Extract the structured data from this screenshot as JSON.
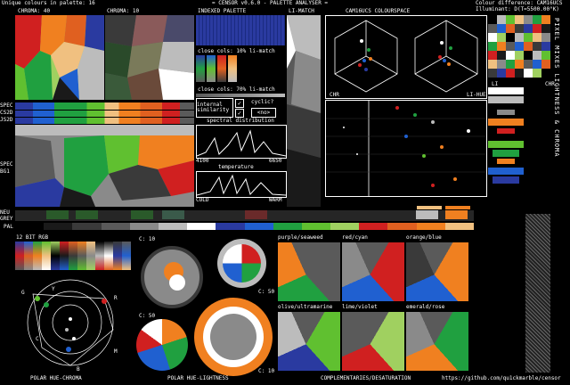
{
  "header": {
    "unique_colours": "Unique colours in palette: 16",
    "app_title": "= CENSOR v0.6.0 - PALETTE ANALYSER =",
    "colour_difference": "Colour difference: CAM16UCS",
    "illuminant": "Illuminant: D(T=5500.00°K)"
  },
  "panels": {
    "chroma_40": "CHROMA: 40",
    "chroma_10": "CHROMA: 10",
    "indexed_palette": "INDEXED PALETTE",
    "li_match": "LI-MATCH",
    "cam16ucs": "CAM16UCS COLOURSPACE",
    "close_cols_10": "close cols: 10% li-match",
    "close_cols_70": "close cols: 70% li-match",
    "internal_similarity": "internal similarity",
    "cyclic": "cyclic?",
    "no_label": "<no>",
    "spectral_distribution": "spectral distribution",
    "spectral_min": "4100",
    "spectral_max": "6650",
    "temperature": "temperature",
    "cold": "COLD",
    "warm": "WARM",
    "chr": "CHR",
    "li_hue": "LI-HUE",
    "li": "LI",
    "chr_right": "CHR",
    "spec": "SPEC",
    "cs2d": "CS2D",
    "js2d": "JS2D",
    "spec_bg1": "SPEC",
    "bg1": "BG1",
    "neu": "NEU",
    "grey": "GREY",
    "pal": "PAL",
    "rgb12": "12 BIT RGB",
    "vertical_label": "PIXEL MIXES   LIGHTNESS & CHROMA"
  },
  "bottom": {
    "c10a": "C: 10",
    "c50a": "C: 50",
    "c50b": "C: 50",
    "c10b": "C: 10",
    "polar_hue_chroma": "POLAR HUE-CHROMA",
    "polar_hue_lightness": "POLAR HUE-LIGHTNESS",
    "complementaries": "COMPLEMENTARIES/DESATURATION",
    "github": "https://github.com/qu1ckmarble/censor",
    "hue_letters": [
      "G",
      "Y",
      "R",
      "C",
      "M",
      "B"
    ],
    "pairs": [
      {
        "label": "purple/seaweed"
      },
      {
        "label": "red/cyan"
      },
      {
        "label": "orange/blue"
      },
      {
        "label": "olive/ultramarine"
      },
      {
        "label": "lime/violet"
      },
      {
        "label": "emerald/rose"
      }
    ]
  },
  "palette": {
    "colors": [
      "#000000",
      "#1a1a1a",
      "#3a3a3a",
      "#5a5a5a",
      "#8a8a8a",
      "#bcbcbc",
      "#ffffff",
      "#2a3aa0",
      "#2060d0",
      "#20a040",
      "#60c030",
      "#a0d060",
      "#d02020",
      "#e06020",
      "#f08020",
      "#f0c080"
    ]
  },
  "accent": {
    "orange": "#f08020",
    "green": "#20a040",
    "blue": "#2060d0",
    "red": "#d02020",
    "grey": "#8a8a8a"
  }
}
